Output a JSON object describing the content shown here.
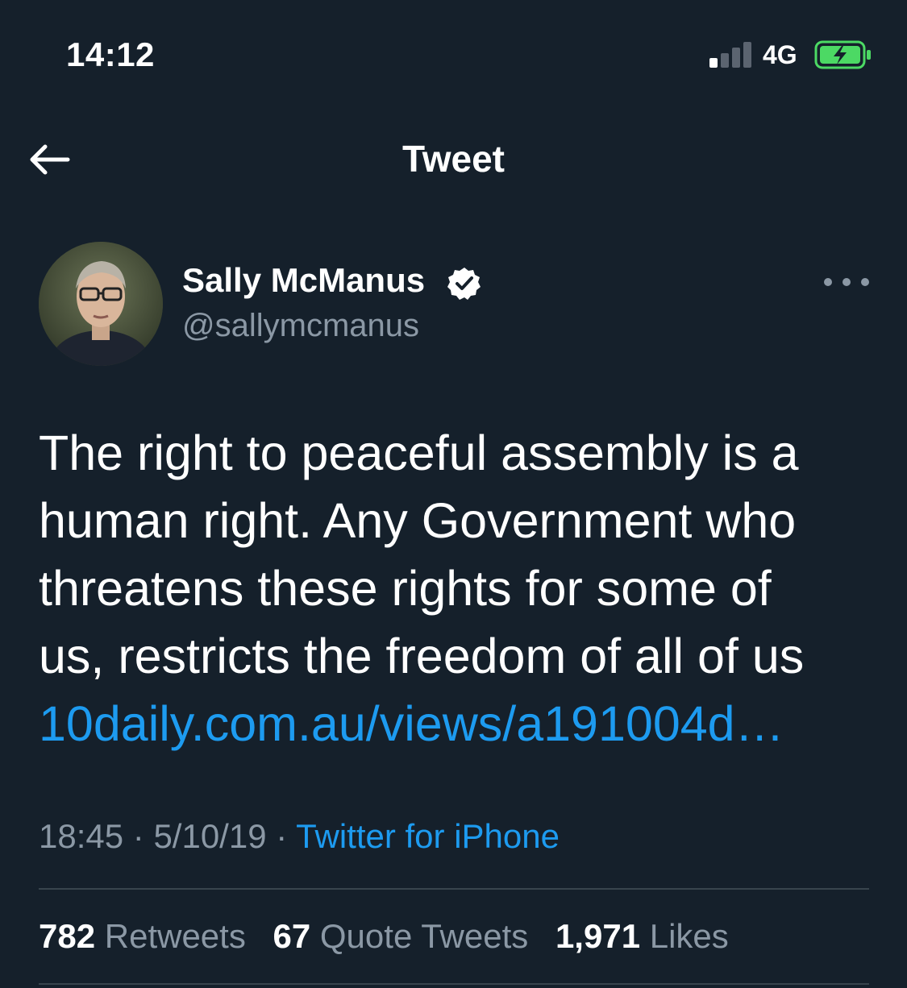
{
  "status_bar": {
    "time": "14:12",
    "network": "4G",
    "signal_bars_active": 1,
    "signal_bars_total": 4,
    "battery_charging": true,
    "battery_color": "#4cd964"
  },
  "header": {
    "back_icon": "arrow-left-icon",
    "title": "Tweet"
  },
  "author": {
    "name": "Sally McManus",
    "handle": "@sallymcmanus",
    "verified": true,
    "verified_icon": "verified-badge-icon"
  },
  "more_icon": "more-dots-icon",
  "tweet": {
    "lines": [
      "The right to peaceful assembly is a",
      "human right. Any Government who",
      "threatens these rights for some of",
      "us, restricts the freedom of all of us"
    ],
    "link": "10daily.com.au/views/a191004d…"
  },
  "meta": {
    "time": "18:45",
    "sep1": " · ",
    "date": "5/10/19",
    "sep2": " · ",
    "source": "Twitter for iPhone"
  },
  "stats": {
    "retweets_count": "782",
    "retweets_label": "Retweets",
    "quotes_count": "67",
    "quotes_label": "Quote Tweets",
    "likes_count": "1,971",
    "likes_label": "Likes"
  },
  "colors": {
    "background": "#15202b",
    "accent": "#1d9bf0",
    "secondary_text": "#8b98a5",
    "divider": "#38444d"
  }
}
